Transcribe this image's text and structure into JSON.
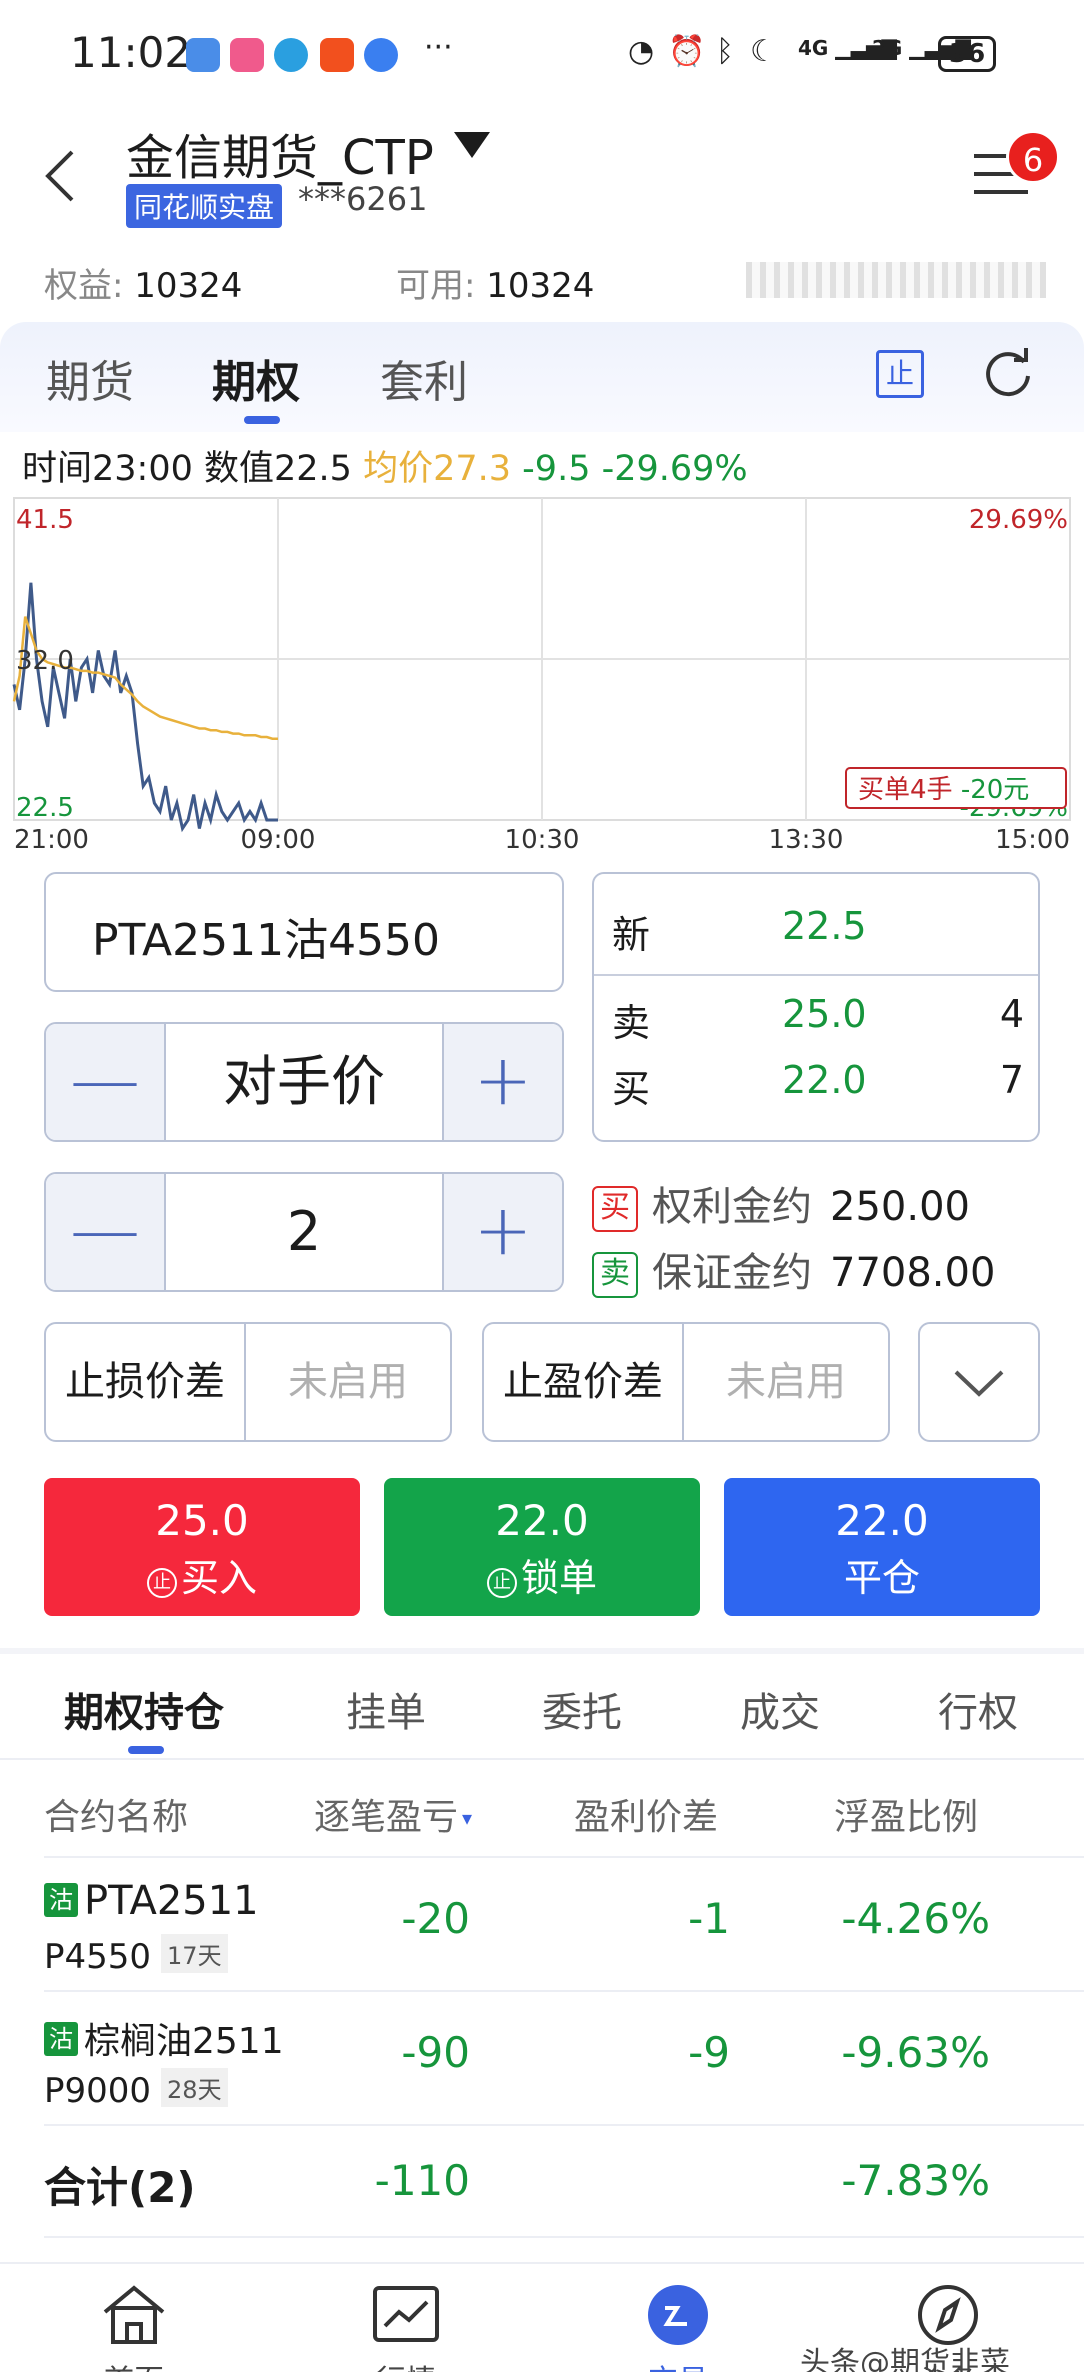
{
  "status_bar": {
    "time": "11:02",
    "more": "···",
    "net1": "4G",
    "net2": "2G",
    "battery": "36"
  },
  "header": {
    "title": "金信期货_CTP",
    "badge": "同花顺实盘",
    "account": "***6261",
    "notification_count": "6",
    "equity_label": "权益:",
    "equity_value": "10324",
    "available_label": "可用:",
    "available_value": "10324"
  },
  "tabs": [
    {
      "label": "期货"
    },
    {
      "label": "期权"
    },
    {
      "label": "套利"
    }
  ],
  "stop_icon_text": "止",
  "chart_info": {
    "time_label": "时间23:00",
    "value_label": "数值22.5",
    "avg_label": "均价27.3",
    "change": "-9.5",
    "change_pct": "-29.69%"
  },
  "chart_data": {
    "type": "line",
    "y_ticks": [
      "41.5",
      "32.0",
      "22.5"
    ],
    "right_ticks": [
      "29.69%",
      "-29.69%"
    ],
    "x_ticks": [
      "21:00",
      "09:00",
      "10:30",
      "13:30",
      "15:00"
    ],
    "ylim": [
      22.5,
      41.5
    ],
    "grid": true,
    "annotation": "买单4手 -20元",
    "annotation_parts": [
      "买单4手",
      "-20元"
    ],
    "series": [
      {
        "values": [
          30.5,
          29.0,
          32.0,
          36.5,
          32.0,
          29.5,
          28.0,
          31.5,
          30.0,
          28.5,
          32.0,
          29.5,
          31.5,
          32.0,
          30.0,
          32.5,
          31.0,
          30.5,
          32.5,
          30.0,
          31.0,
          30.0,
          27.0,
          24.5,
          25.0,
          23.5,
          23.0,
          24.5,
          22.5,
          23.5,
          22.0,
          22.5,
          24.0,
          22.0,
          23.5,
          22.5,
          24.0,
          23.0,
          22.5,
          23.0,
          23.5,
          22.5,
          23.0,
          22.5,
          23.5,
          22.5,
          22.5,
          22.5
        ],
        "color": "#3f5a8a"
      },
      {
        "values": [
          29.5,
          31.0,
          34.5,
          33.5,
          32.5,
          32.0,
          31.8,
          31.7,
          31.6,
          31.5,
          31.5,
          31.4,
          31.3,
          31.3,
          31.2,
          31.2,
          31.1,
          31.0,
          30.9,
          30.5,
          30.2,
          29.9,
          29.5,
          29.2,
          29.0,
          28.8,
          28.6,
          28.5,
          28.4,
          28.3,
          28.2,
          28.1,
          28.0,
          27.9,
          27.9,
          27.8,
          27.8,
          27.7,
          27.7,
          27.6,
          27.6,
          27.5,
          27.5,
          27.5,
          27.4,
          27.4,
          27.3,
          27.3
        ],
        "color": "#e8b13c"
      }
    ]
  },
  "order": {
    "contract": "PTA2511沽4550",
    "price_mode": "对手价",
    "quantity": "2",
    "minus": "—",
    "plus": "+",
    "quote": {
      "last_label": "新",
      "last_value": "22.5",
      "ask_label": "卖",
      "ask_value": "25.0",
      "ask_vol": "4",
      "bid_label": "买",
      "bid_value": "22.0",
      "bid_vol": "7"
    },
    "premium_tag": "买",
    "premium_label": "权利金约",
    "premium_value": "250.00",
    "margin_tag": "卖",
    "margin_label": "保证金约",
    "margin_value": "7708.00",
    "stop_loss_label": "止损价差",
    "stop_loss_value": "未启用",
    "take_profit_label": "止盈价差",
    "take_profit_value": "未启用",
    "buttons": {
      "buy_price": "25.0",
      "buy_label": "买入",
      "lock_price": "22.0",
      "lock_label": "锁单",
      "close_price": "22.0",
      "close_label": "平仓",
      "shield_char": "止"
    }
  },
  "positions": {
    "tabs": [
      "期权持仓",
      "挂单",
      "委托",
      "成交",
      "行权"
    ],
    "headers": [
      "合约名称",
      "逐笔盈亏",
      "盈利价差",
      "浮盈比例"
    ],
    "rows": [
      {
        "tag": "沽",
        "name": "PTA2511",
        "strike": "P4550",
        "days": "17天",
        "pnl": "-20",
        "spread": "-1",
        "ratio": "-4.26%"
      },
      {
        "tag": "沽",
        "name": "棕榈油2511",
        "strike": "P9000",
        "days": "28天",
        "pnl": "-90",
        "spread": "-9",
        "ratio": "-9.63%"
      }
    ],
    "total": {
      "label": "合计(2)",
      "pnl": "-110",
      "ratio": "-7.83%"
    }
  },
  "bottom_nav": [
    {
      "label": "首页"
    },
    {
      "label": "行情"
    },
    {
      "label": "交易"
    },
    {
      "label": "头条"
    }
  ],
  "watermark": "头条@期货韭菜"
}
